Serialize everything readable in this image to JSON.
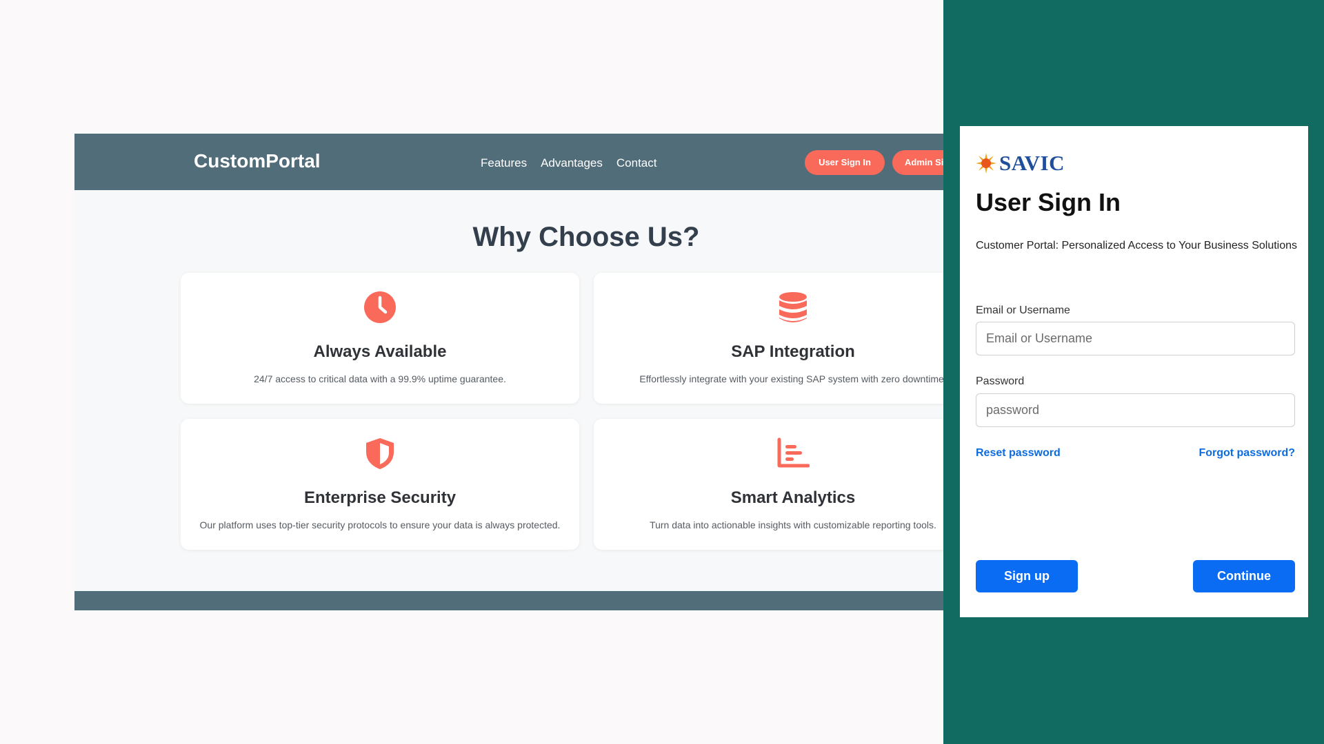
{
  "portal": {
    "brand": "CustomPortal",
    "nav": [
      "Features",
      "Advantages",
      "Contact"
    ],
    "user_signin": "User Sign In",
    "admin_signin": "Admin Si",
    "section_title": "Why Choose Us?",
    "accent_color": "#f96a5a",
    "nav_color": "#526d7a",
    "features": [
      {
        "icon": "clock-icon",
        "title": "Always Available",
        "desc": "24/7 access to critical data with a 99.9% uptime guarantee."
      },
      {
        "icon": "database-icon",
        "title": "SAP Integration",
        "desc": "Effortlessly integrate with your existing SAP system with zero downtime."
      },
      {
        "icon": "shield-icon",
        "title": "Enterprise Security",
        "desc": "Our platform uses top-tier security protocols to ensure your data is always protected."
      },
      {
        "icon": "bar-chart-icon",
        "title": "Smart Analytics",
        "desc": "Turn data into actionable insights with customizable reporting tools."
      }
    ]
  },
  "signin": {
    "logo": "SAVIC",
    "title": "User Sign In",
    "subtitle": "Customer Portal: Personalized Access to Your Business Solutions",
    "email_label": "Email or Username",
    "email_placeholder": "Email or Username",
    "password_label": "Password",
    "password_placeholder": "password",
    "reset_link": "Reset password",
    "forgot_link": "Forgot password?",
    "signup_button": "Sign up",
    "continue_button": "Continue",
    "panel_color": "#126b61",
    "button_color": "#0a6cf2"
  }
}
